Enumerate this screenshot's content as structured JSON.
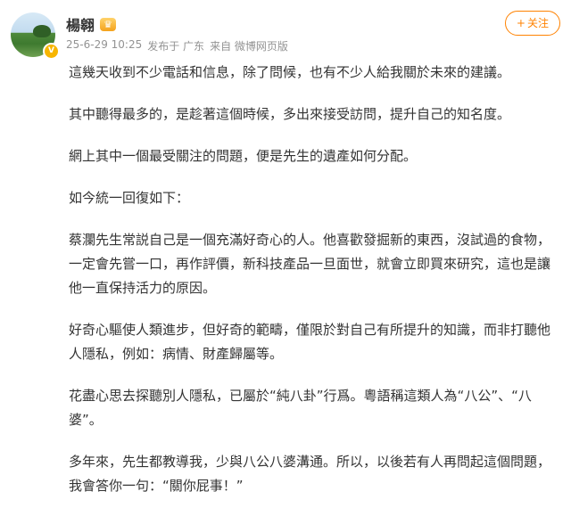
{
  "post": {
    "author": {
      "name": "楊翱",
      "verified_badge": "V",
      "member_badge": "crown-icon"
    },
    "meta": {
      "timestamp": "25-6-29 10:25",
      "location": "发布于 广东",
      "source": "来自 微博网页版"
    },
    "follow_button": {
      "plus": "+",
      "label": "关注"
    },
    "paragraphs": [
      "這幾天收到不少電話和信息，除了問候，也有不少人給我關於未來的建議。",
      "其中聽得最多的，是趁著這個時候，多出來接受訪問，提升自己的知名度。",
      "網上其中一個最受關注的問題，便是先生的遺產如何分配。",
      "如今統一回復如下：",
      "蔡瀾先生常説自己是一個充滿好奇心的人。他喜歡發掘新的東西，沒試過的食物，一定會先嘗一口，再作評價，新科技產品一旦面世，就會立即買來研究，這也是讓他一直保持活力的原因。",
      "好奇心驅使人類進步，但好奇的範疇，僅限於對自己有所提升的知識，而非打聽他人隱私，例如：病情、財產歸屬等。",
      "花盡心思去探聽別人隱私，已屬於“純八卦”行爲。粵語稱這類人為“八公”、“八婆”。",
      "多年來，先生都教導我，少與八公八婆溝通。所以，以後若有人再問起這個問題，我會答你一句：“關你屁事！”"
    ]
  },
  "colors": {
    "accent": "#ff8200",
    "meta_text": "#939393",
    "body_text": "#333333"
  }
}
